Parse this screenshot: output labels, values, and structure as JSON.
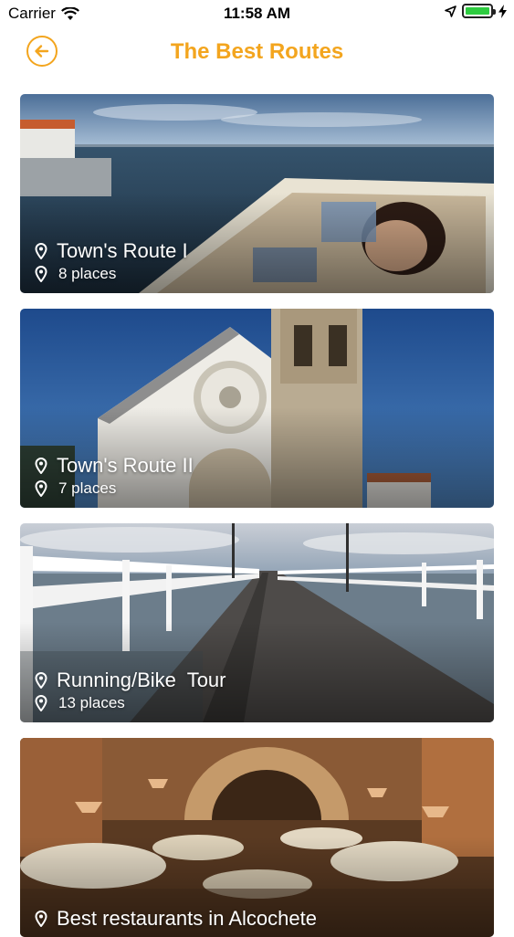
{
  "status_bar": {
    "carrier": "Carrier",
    "time": "11:58 AM"
  },
  "header": {
    "title": "The Best Routes"
  },
  "routes": [
    {
      "name": "Town's Route I",
      "places": "8 places"
    },
    {
      "name": "Town's Route II",
      "places": "7 places"
    },
    {
      "name": "Running/Bike  Tour",
      "places": "13 places"
    },
    {
      "name": "Best restaurants in Alcochete",
      "places": ""
    }
  ],
  "colors": {
    "accent": "#f3a51e",
    "battery": "#2ecc40"
  },
  "icons": [
    "wifi-icon",
    "location-arrow-icon",
    "battery-icon",
    "charging-bolt-icon",
    "back-arrow-icon",
    "map-pin-icon"
  ]
}
